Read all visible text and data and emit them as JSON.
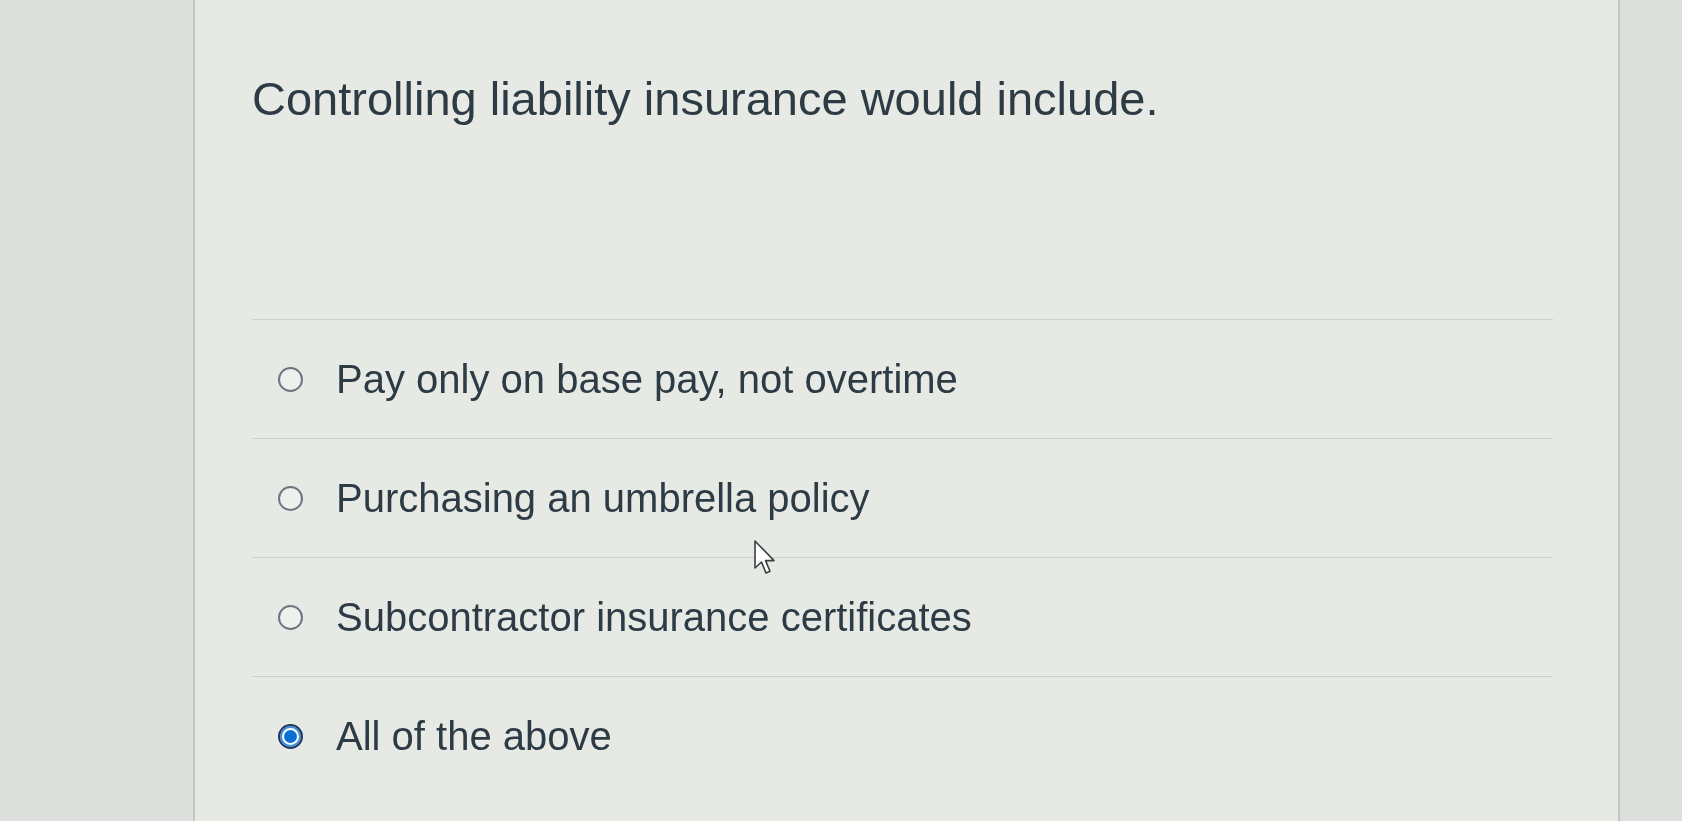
{
  "question": {
    "text": "Controlling liability insurance would include."
  },
  "options": [
    {
      "label": "Pay only on base pay, not overtime",
      "selected": false
    },
    {
      "label": "Purchasing an umbrella policy",
      "selected": false
    },
    {
      "label": "Subcontractor insurance certificates",
      "selected": false
    },
    {
      "label": "All of the above",
      "selected": true
    }
  ]
}
